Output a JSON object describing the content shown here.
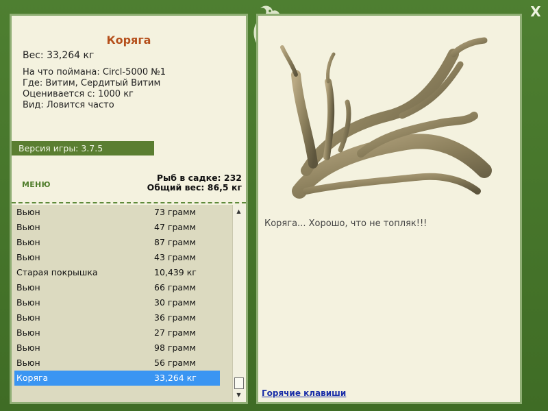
{
  "window": {
    "close_label": "X"
  },
  "item": {
    "title": "Коряга",
    "weight": "Вес: 33,264 кг",
    "caught_with": "На что поймана: Circl-5000 №1",
    "location": "Где: Витим, Сердитый Витим",
    "valued_from": "Оценивается с: 1000 кг",
    "frequency": "Вид: Ловится часто",
    "description": "Коряга... Хорошо, что не топляк!!!"
  },
  "version": "Версия игры: 3.7.5",
  "menu_label": "МЕНЮ",
  "stats": {
    "fish_count": "Рыб в садке: 232",
    "total_weight": "Общий вес: 86,5 кг"
  },
  "catch_list": [
    {
      "name": "Вьюн",
      "weight": "73 грамм"
    },
    {
      "name": "Вьюн",
      "weight": "47 грамм"
    },
    {
      "name": "Вьюн",
      "weight": "87 грамм"
    },
    {
      "name": "Вьюн",
      "weight": "43 грамм"
    },
    {
      "name": "Старая покрышка",
      "weight": "10,439 кг"
    },
    {
      "name": "Вьюн",
      "weight": "66 грамм"
    },
    {
      "name": "Вьюн",
      "weight": "30 грамм"
    },
    {
      "name": "Вьюн",
      "weight": "36 грамм"
    },
    {
      "name": "Вьюн",
      "weight": "27 грамм"
    },
    {
      "name": "Вьюн",
      "weight": "98 грамм"
    },
    {
      "name": "Вьюн",
      "weight": "56 грамм"
    },
    {
      "name": "Коряга",
      "weight": "33,264 кг",
      "selected": true
    }
  ],
  "hotkeys_label": "Горячие клавиши",
  "icons": {
    "close": "close-icon",
    "logo": "dragon-logo-icon",
    "scroll_up": "scroll-up-arrow-icon",
    "scroll_down": "scroll-down-arrow-icon"
  },
  "colors": {
    "frame": "#4a7a2e",
    "panel": "#f4f2df",
    "title": "#b5501c",
    "version_bar": "#5a7e31",
    "selected_row": "#3a95f2",
    "link": "#1a2ea8"
  }
}
